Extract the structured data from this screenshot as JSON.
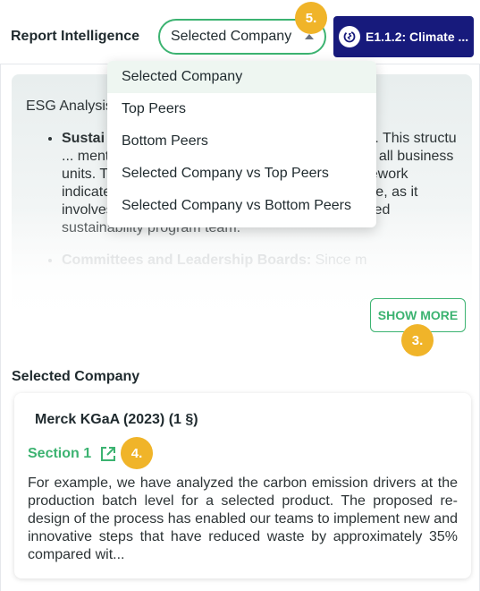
{
  "header": {
    "title": "Report Intelligence",
    "select_value": "Selected Company",
    "context_label": "E1.1.2: Climate ...",
    "context_icon": "refresh-circle-icon"
  },
  "badges": {
    "dropdown": "5.",
    "show_more": "3.",
    "section_link": "4."
  },
  "dropdown": {
    "options": [
      "Selected Company",
      "Top Peers",
      "Bottom Peers",
      "Selected Company vs Top Peers",
      "Selected Company vs Bottom Peers"
    ],
    "active_index": 0
  },
  "esg": {
    "intro": "ESG Analysis ... Merck KGaA (2023):",
    "bullet1_lead": "Sustai",
    "bullet1_text": " ... GaA has implem ... overnance structu ... This structu ... mentation of their sustainability strategy across all business units. The establishment of this governance framework indicates a significant focus on climate governance, as it involves multiple leadership boards and a dedicated sustainability program team.",
    "bullet2_lead": "Committees and Leadership Boards:",
    "bullet2_text": " Since m",
    "show_more_label": "SHOW MORE"
  },
  "selected": {
    "section_title": "Selected Company",
    "card_title": "Merck KGaA (2023) (1 §)",
    "section_link": "Section 1",
    "body": "For example, we have analyzed the carbon emission drivers at the production batch level for a selected product. The proposed re-design of the process has enabled our teams to implement new and innovative steps that have reduced waste by approximately 35% compared wit..."
  },
  "colors": {
    "accent_green": "#3cb371",
    "context_button_bg": "#171a7c",
    "badge_yellow": "#f0b429"
  }
}
